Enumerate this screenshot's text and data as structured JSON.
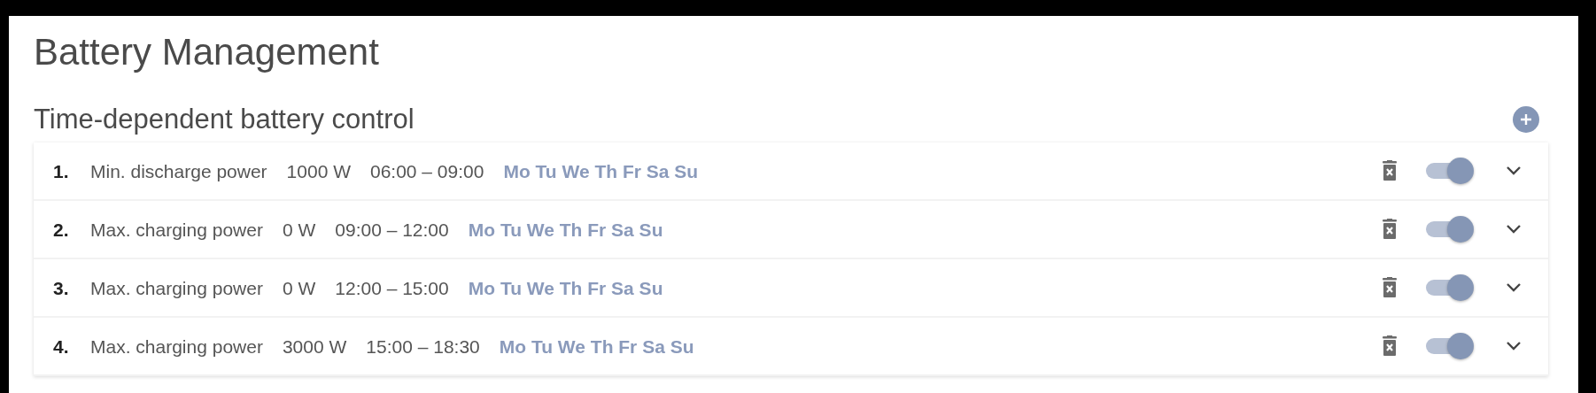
{
  "title": "Battery Management",
  "section": {
    "title": "Time-dependent battery control"
  },
  "rules": [
    {
      "number": "1.",
      "type": "Min. discharge power",
      "power": "1000 W",
      "time": "06:00 – 09:00",
      "days": "Mo Tu We Th Fr Sa Su",
      "on": true
    },
    {
      "number": "2.",
      "type": "Max. charging power",
      "power": "0 W",
      "time": "09:00 – 12:00",
      "days": "Mo Tu We Th Fr Sa Su",
      "on": true
    },
    {
      "number": "3.",
      "type": "Max. charging power",
      "power": "0 W",
      "time": "12:00 – 15:00",
      "days": "Mo Tu We Th Fr Sa Su",
      "on": true
    },
    {
      "number": "4.",
      "type": "Max. charging power",
      "power": "3000 W",
      "time": "15:00 – 18:30",
      "days": "Mo Tu We Th Fr Sa Su",
      "on": true
    }
  ]
}
